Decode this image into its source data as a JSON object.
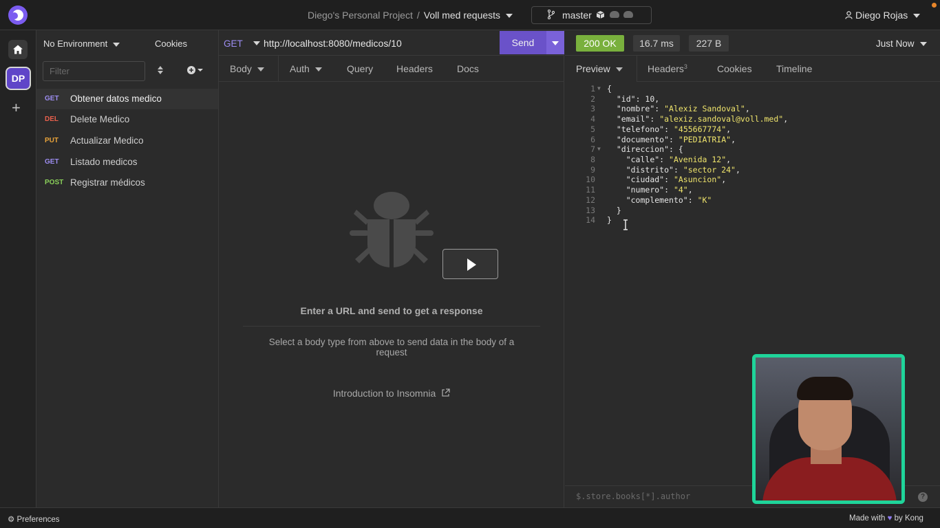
{
  "titlebar": {
    "project": "Diego's Personal Project",
    "separator": "/",
    "collection": "Voll med requests",
    "branch": "master",
    "user": "Diego Rojas"
  },
  "rail": {
    "workspace_initials": "DP",
    "add_symbol": "+"
  },
  "sidebar": {
    "environment": "No Environment",
    "cookies_label": "Cookies",
    "filter_placeholder": "Filter",
    "requests": [
      {
        "method": "GET",
        "name": "Obtener datos medico",
        "active": true
      },
      {
        "method": "DEL",
        "name": "Delete Medico",
        "active": false
      },
      {
        "method": "PUT",
        "name": "Actualizar Medico",
        "active": false
      },
      {
        "method": "GET",
        "name": "Listado medicos",
        "active": false
      },
      {
        "method": "POST",
        "name": "Registrar médicos",
        "active": false
      }
    ]
  },
  "request": {
    "method": "GET",
    "url": "http://localhost:8080/medicos/10",
    "send_label": "Send",
    "tabs": [
      "Body",
      "Auth",
      "Query",
      "Headers",
      "Docs"
    ],
    "empty_title": "Enter a URL and send to get a response",
    "empty_subtitle": "Select a body type from above to send data in the body of a request",
    "intro_link": "Introduction to Insomnia"
  },
  "response": {
    "status": "200 OK",
    "time": "16.7 ms",
    "size": "227 B",
    "timestamp": "Just Now",
    "tabs": {
      "preview": "Preview",
      "headers": "Headers",
      "headers_count": "3",
      "cookies": "Cookies",
      "timeline": "Timeline"
    },
    "body_lines": [
      "{",
      "  \"id\": 10,",
      "  \"nombre\": \"Alexiz Sandoval\",",
      "  \"email\": \"alexiz.sandoval@voll.med\",",
      "  \"telefono\": \"455667774\",",
      "  \"documento\": \"PEDIATRIA\",",
      "  \"direccion\": {",
      "    \"calle\": \"Avenida 12\",",
      "    \"distrito\": \"sector 24\",",
      "    \"ciudad\": \"Asuncion\",",
      "    \"numero\": \"4\",",
      "    \"complemento\": \"K\"",
      "  }",
      "}"
    ],
    "filter_placeholder": "$.store.books[*].author",
    "help_symbol": "?"
  },
  "statusbar": {
    "preferences": "Preferences",
    "made_with": "Made with",
    "by": "by Kong"
  },
  "colors": {
    "accent": "#6a52c9",
    "status_ok": "#79b03d",
    "webcam_border": "#1fd49a",
    "method_get": "#9d8df1",
    "method_del": "#e8604c",
    "method_put": "#e8a33a",
    "method_post": "#8ad05a"
  }
}
